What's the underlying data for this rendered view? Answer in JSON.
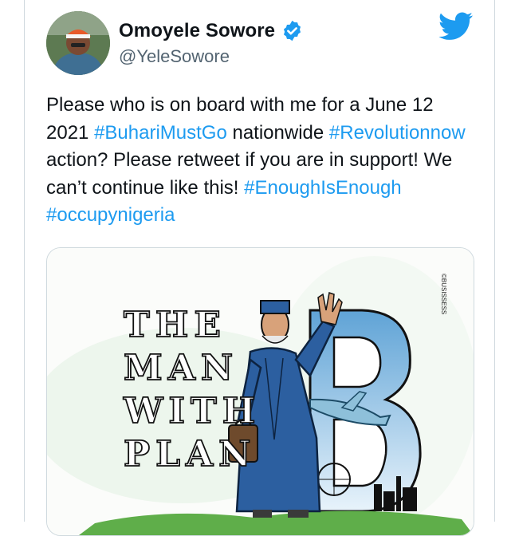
{
  "author": {
    "display_name": "Omoyele Sowore",
    "handle": "@YeleSowore",
    "verified": true,
    "avatar_icon": "user-avatar"
  },
  "brand": {
    "icon": "twitter-bird-icon",
    "color": "#1d9bf0"
  },
  "tweet": {
    "segments": [
      {
        "text": "Please who is on board with me for a June 12 2021 ",
        "hashtag": false
      },
      {
        "text": "#BuhariMustGo",
        "hashtag": true
      },
      {
        "text": " nationwide ",
        "hashtag": false
      },
      {
        "text": "#Revolutionnow",
        "hashtag": true
      },
      {
        "text": " action? Please retweet if you are in support! We can’t continue like this! ",
        "hashtag": false
      },
      {
        "text": "#EnoughIsEnough",
        "hashtag": true
      },
      {
        "text": " ",
        "hashtag": false
      },
      {
        "text": "#occupynigeria",
        "hashtag": true
      }
    ]
  },
  "media": {
    "cartoon_words": [
      "THE",
      "MAN",
      "WITH",
      "PLAN"
    ],
    "big_letter": "B",
    "credit": "©BUSISSESS"
  },
  "colors": {
    "hashtag": "#1d9bf0",
    "handle": "#536471",
    "border": "#cfd9de",
    "robe": "#2c5fa0"
  }
}
